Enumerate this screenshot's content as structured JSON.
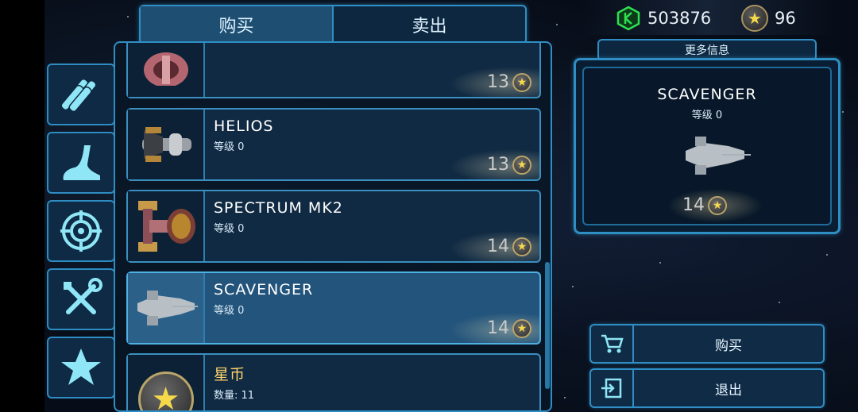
{
  "tabs": {
    "buy": "购买",
    "sell": "卖出"
  },
  "currency": {
    "credits": "503876",
    "stars": "96"
  },
  "categories": [
    {
      "icon": "pipes-icon"
    },
    {
      "icon": "boot-icon"
    },
    {
      "icon": "target-icon"
    },
    {
      "icon": "tools-icon"
    },
    {
      "icon": "star-icon"
    }
  ],
  "items": [
    {
      "name": "",
      "level": "",
      "price": "13"
    },
    {
      "name": "HELIOS",
      "level": "等级 0",
      "price": "13"
    },
    {
      "name": "SPECTRUM MK2",
      "level": "等级 0",
      "price": "14"
    },
    {
      "name": "SCAVENGER",
      "level": "等级 0",
      "price": "14",
      "selected": true
    },
    {
      "name": "星币",
      "level": "数量: 11"
    }
  ],
  "info": {
    "more_info_label": "更多信息",
    "name": "SCAVENGER",
    "level": "等级 0",
    "price": "14"
  },
  "actions": {
    "buy_label": "购买",
    "exit_label": "退出"
  },
  "colors": {
    "accent": "#2f8fc4",
    "selected": "#23547b",
    "coin": "#f5d94a",
    "credit_icon": "#2ee04f"
  }
}
